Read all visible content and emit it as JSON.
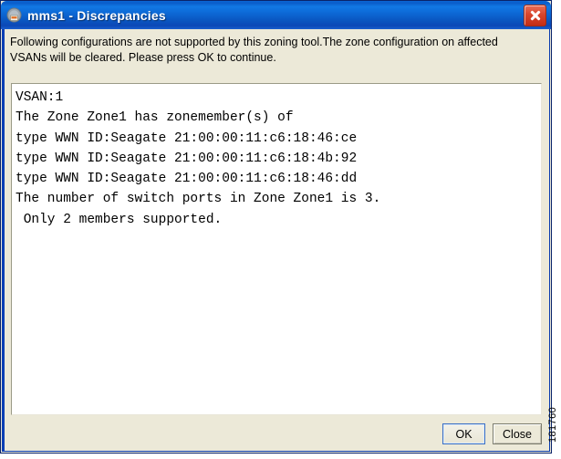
{
  "window": {
    "title": "mms1 - Discrepancies",
    "icon": "application-icon",
    "close_label": "✕",
    "accent_color": "#0a55c0",
    "close_color": "#c42d16",
    "client_bg": "#ece9d8"
  },
  "message": {
    "line1": "Following configurations are not supported by this zoning tool.The zone configuration on affected",
    "line2": "VSANs will be cleared.  Please press OK to continue."
  },
  "details": {
    "text": "VSAN:1\nThe Zone Zone1 has zonemember(s) of\ntype WWN ID:Seagate 21:00:00:11:c6:18:46:ce\ntype WWN ID:Seagate 21:00:00:11:c6:18:4b:92\ntype WWN ID:Seagate 21:00:00:11:c6:18:46:dd\nThe number of switch ports in Zone Zone1 is 3.\n Only 2 members supported.",
    "lines": [
      "VSAN:1",
      "The Zone Zone1 has zonemember(s) of",
      "type WWN ID:Seagate 21:00:00:11:c6:18:46:ce",
      "type WWN ID:Seagate 21:00:00:11:c6:18:4b:92",
      "type WWN ID:Seagate 21:00:00:11:c6:18:46:dd",
      "The number of switch ports in Zone Zone1 is 3.",
      " Only 2 members supported."
    ]
  },
  "buttons": {
    "ok": "OK",
    "close": "Close"
  },
  "watermark": {
    "id": "181760"
  }
}
